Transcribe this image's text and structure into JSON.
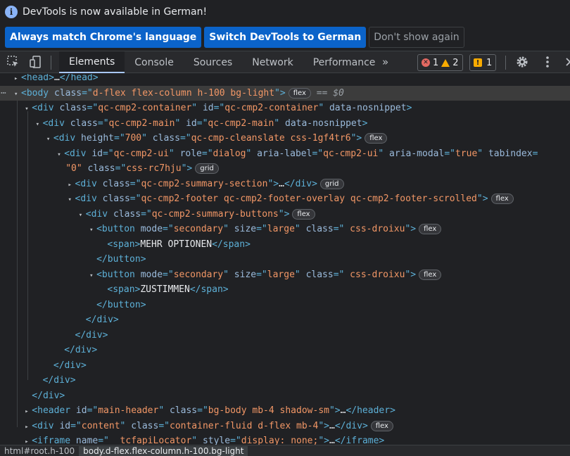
{
  "infobar": {
    "message": "DevTools is now available in German!",
    "buttons": [
      "Always match Chrome's language",
      "Switch DevTools to German",
      "Don't show again"
    ]
  },
  "tabs": [
    "Elements",
    "Console",
    "Sources",
    "Network",
    "Performance"
  ],
  "more_tabs": "»",
  "counters": {
    "errors": "1",
    "warnings": "2",
    "issues": "1"
  },
  "colors": {
    "tag": "#5db0d7",
    "attr": "#9bbbdc",
    "value": "#f29766",
    "accent": "#a8c7fa"
  },
  "tree": [
    {
      "indent": 0,
      "arrow": "▸",
      "html": [
        [
          "tag",
          "<head>"
        ],
        [
          "txt",
          "…"
        ],
        [
          "tag",
          "</head>"
        ]
      ]
    },
    {
      "indent": 0,
      "arrow": "▾",
      "sel": true,
      "html": [
        [
          "tag",
          "<body "
        ],
        [
          "attr",
          "class"
        ],
        [
          "tag",
          "=\""
        ],
        [
          "val",
          "d-flex flex-column h-100 bg-light"
        ],
        [
          "tag",
          "\">"
        ]
      ],
      "badge": "flex",
      "extra": " == $0"
    },
    {
      "indent": 1,
      "arrow": "▾",
      "html": [
        [
          "tag",
          "<div "
        ],
        [
          "attr",
          "class"
        ],
        [
          "tag",
          "=\""
        ],
        [
          "val",
          "qc-cmp2-container"
        ],
        [
          "tag",
          "\" "
        ],
        [
          "attr",
          "id"
        ],
        [
          "tag",
          "=\""
        ],
        [
          "val",
          "qc-cmp2-container"
        ],
        [
          "tag",
          "\" "
        ],
        [
          "attr",
          "data-nosnippet"
        ],
        [
          "tag",
          ">"
        ]
      ]
    },
    {
      "indent": 2,
      "arrow": "▾",
      "html": [
        [
          "tag",
          "<div "
        ],
        [
          "attr",
          "class"
        ],
        [
          "tag",
          "=\""
        ],
        [
          "val",
          "qc-cmp2-main"
        ],
        [
          "tag",
          "\" "
        ],
        [
          "attr",
          "id"
        ],
        [
          "tag",
          "=\""
        ],
        [
          "val",
          "qc-cmp2-main"
        ],
        [
          "tag",
          "\" "
        ],
        [
          "attr",
          "data-nosnippet"
        ],
        [
          "tag",
          ">"
        ]
      ]
    },
    {
      "indent": 3,
      "arrow": "▾",
      "html": [
        [
          "tag",
          "<div "
        ],
        [
          "attr",
          "height"
        ],
        [
          "tag",
          "=\""
        ],
        [
          "val",
          "700"
        ],
        [
          "tag",
          "\" "
        ],
        [
          "attr",
          "class"
        ],
        [
          "tag",
          "=\""
        ],
        [
          "val",
          "qc-cmp-cleanslate css-1gf4tr6"
        ],
        [
          "tag",
          "\">"
        ]
      ],
      "badge": "flex"
    },
    {
      "indent": 4,
      "arrow": "▾",
      "html": [
        [
          "tag",
          "<div "
        ],
        [
          "attr",
          "id"
        ],
        [
          "tag",
          "=\""
        ],
        [
          "val",
          "qc-cmp2-ui"
        ],
        [
          "tag",
          "\" "
        ],
        [
          "attr",
          "role"
        ],
        [
          "tag",
          "=\""
        ],
        [
          "val",
          "dialog"
        ],
        [
          "tag",
          "\" "
        ],
        [
          "attr",
          "aria-label"
        ],
        [
          "tag",
          "=\""
        ],
        [
          "val",
          "qc-cmp2-ui"
        ],
        [
          "tag",
          "\" "
        ],
        [
          "attr",
          "aria-modal"
        ],
        [
          "tag",
          "=\""
        ],
        [
          "val",
          "true"
        ],
        [
          "tag",
          "\" "
        ],
        [
          "attr",
          "tabindex"
        ],
        [
          "tag",
          "="
        ]
      ]
    },
    {
      "indent": 4,
      "arrow": "",
      "cont": true,
      "html": [
        [
          "val",
          "\"0\" "
        ],
        [
          "attr",
          "class"
        ],
        [
          "tag",
          "=\""
        ],
        [
          "val",
          "css-rc7hju"
        ],
        [
          "tag",
          "\">"
        ]
      ],
      "badge": "grid"
    },
    {
      "indent": 5,
      "arrow": "▸",
      "html": [
        [
          "tag",
          "<div "
        ],
        [
          "attr",
          "class"
        ],
        [
          "tag",
          "=\""
        ],
        [
          "val",
          "qc-cmp2-summary-section"
        ],
        [
          "tag",
          "\">"
        ],
        [
          "txt",
          "…"
        ],
        [
          "tag",
          "</div>"
        ]
      ],
      "badge": "grid"
    },
    {
      "indent": 5,
      "arrow": "▾",
      "html": [
        [
          "tag",
          "<div "
        ],
        [
          "attr",
          "class"
        ],
        [
          "tag",
          "=\""
        ],
        [
          "val",
          "qc-cmp2-footer qc-cmp2-footer-overlay qc-cmp2-footer-scrolled"
        ],
        [
          "tag",
          "\">"
        ]
      ],
      "badge": "flex"
    },
    {
      "indent": 6,
      "arrow": "▾",
      "html": [
        [
          "tag",
          "<div "
        ],
        [
          "attr",
          "class"
        ],
        [
          "tag",
          "=\""
        ],
        [
          "val",
          "qc-cmp2-summary-buttons"
        ],
        [
          "tag",
          "\">"
        ]
      ],
      "badge": "flex"
    },
    {
      "indent": 7,
      "arrow": "▾",
      "html": [
        [
          "tag",
          "<button "
        ],
        [
          "attr",
          "mode"
        ],
        [
          "tag",
          "=\""
        ],
        [
          "val",
          "secondary"
        ],
        [
          "tag",
          "\" "
        ],
        [
          "attr",
          "size"
        ],
        [
          "tag",
          "=\""
        ],
        [
          "val",
          "large"
        ],
        [
          "tag",
          "\" "
        ],
        [
          "attr",
          "class"
        ],
        [
          "tag",
          "=\""
        ],
        [
          "val",
          " css-droixu"
        ],
        [
          "tag",
          "\">"
        ]
      ],
      "badge": "flex"
    },
    {
      "indent": 8,
      "arrow": "",
      "html": [
        [
          "tag",
          "<span>"
        ],
        [
          "txt",
          "MEHR OPTIONEN"
        ],
        [
          "tag",
          "</span>"
        ]
      ]
    },
    {
      "indent": 7,
      "arrow": "",
      "html": [
        [
          "tag",
          "</button>"
        ]
      ]
    },
    {
      "indent": 7,
      "arrow": "▾",
      "html": [
        [
          "tag",
          "<button "
        ],
        [
          "attr",
          "mode"
        ],
        [
          "tag",
          "=\""
        ],
        [
          "val",
          "secondary"
        ],
        [
          "tag",
          "\" "
        ],
        [
          "attr",
          "size"
        ],
        [
          "tag",
          "=\""
        ],
        [
          "val",
          "large"
        ],
        [
          "tag",
          "\" "
        ],
        [
          "attr",
          "class"
        ],
        [
          "tag",
          "=\""
        ],
        [
          "val",
          " css-droixu"
        ],
        [
          "tag",
          "\">"
        ]
      ],
      "badge": "flex"
    },
    {
      "indent": 8,
      "arrow": "",
      "html": [
        [
          "tag",
          "<span>"
        ],
        [
          "txt",
          "ZUSTIMMEN"
        ],
        [
          "tag",
          "</span>"
        ]
      ]
    },
    {
      "indent": 7,
      "arrow": "",
      "html": [
        [
          "tag",
          "</button>"
        ]
      ]
    },
    {
      "indent": 6,
      "arrow": "",
      "html": [
        [
          "tag",
          "</div>"
        ]
      ]
    },
    {
      "indent": 5,
      "arrow": "",
      "html": [
        [
          "tag",
          "</div>"
        ]
      ]
    },
    {
      "indent": 4,
      "arrow": "",
      "html": [
        [
          "tag",
          "</div>"
        ]
      ]
    },
    {
      "indent": 3,
      "arrow": "",
      "html": [
        [
          "tag",
          "</div>"
        ]
      ]
    },
    {
      "indent": 2,
      "arrow": "",
      "html": [
        [
          "tag",
          "</div>"
        ]
      ]
    },
    {
      "indent": 1,
      "arrow": "",
      "html": [
        [
          "tag",
          "</div>"
        ]
      ]
    },
    {
      "indent": 1,
      "arrow": "▸",
      "html": [
        [
          "tag",
          "<header "
        ],
        [
          "attr",
          "id"
        ],
        [
          "tag",
          "=\""
        ],
        [
          "val",
          "main-header"
        ],
        [
          "tag",
          "\" "
        ],
        [
          "attr",
          "class"
        ],
        [
          "tag",
          "=\""
        ],
        [
          "val",
          "bg-body mb-4 shadow-sm"
        ],
        [
          "tag",
          "\">"
        ],
        [
          "txt",
          "…"
        ],
        [
          "tag",
          "</header>"
        ]
      ]
    },
    {
      "indent": 1,
      "arrow": "▸",
      "html": [
        [
          "tag",
          "<div "
        ],
        [
          "attr",
          "id"
        ],
        [
          "tag",
          "=\""
        ],
        [
          "val",
          "content"
        ],
        [
          "tag",
          "\" "
        ],
        [
          "attr",
          "class"
        ],
        [
          "tag",
          "=\""
        ],
        [
          "val",
          "container-fluid d-flex mb-4"
        ],
        [
          "tag",
          "\">"
        ],
        [
          "txt",
          "…"
        ],
        [
          "tag",
          "</div>"
        ]
      ],
      "badge": "flex"
    },
    {
      "indent": 1,
      "arrow": "▸",
      "html": [
        [
          "tag",
          "<iframe "
        ],
        [
          "attr",
          "name"
        ],
        [
          "tag",
          "=\""
        ],
        [
          "val",
          "__tcfapiLocator"
        ],
        [
          "tag",
          "\" "
        ],
        [
          "attr",
          "style"
        ],
        [
          "tag",
          "=\""
        ],
        [
          "val",
          "display: none;"
        ],
        [
          "tag",
          "\">"
        ],
        [
          "txt",
          "…"
        ],
        [
          "tag",
          "</iframe>"
        ]
      ]
    }
  ],
  "breadcrumbs": [
    "html#root.h-100",
    "body.d-flex.flex-column.h-100.bg-light"
  ]
}
